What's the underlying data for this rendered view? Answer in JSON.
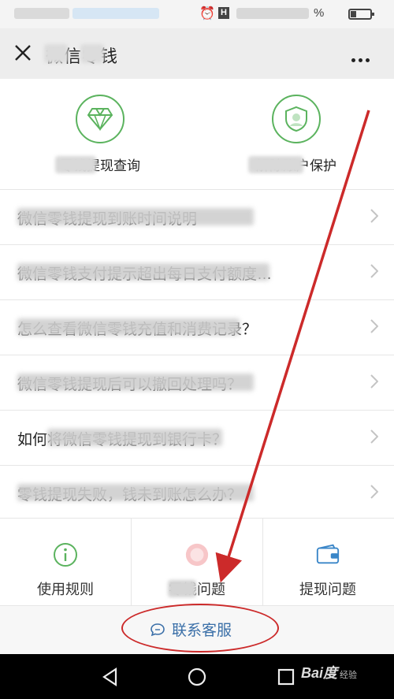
{
  "status_bar": {
    "battery_suffix": "%"
  },
  "header": {
    "title": "微信零钱"
  },
  "features": [
    {
      "label": "零钱提现查询"
    },
    {
      "label": "解除账户保护"
    }
  ],
  "faq": [
    {
      "text": "微信零钱提现到账时间说明"
    },
    {
      "text": "微信零钱支付提示超出每日支付额度…"
    },
    {
      "text": "怎么查看微信零钱充值和消费记录？"
    },
    {
      "text": "微信零钱提现后可以撤回处理吗？"
    },
    {
      "text": "如何将微信零钱提现到银行卡？"
    },
    {
      "text": "零钱提现失败，钱未到账怎么办？"
    }
  ],
  "bottom_tabs": [
    {
      "label": "使用规则",
      "icon": "info-icon"
    },
    {
      "label": "零钱问题",
      "icon": "coin-icon"
    },
    {
      "label": "提现问题",
      "icon": "wallet-icon"
    }
  ],
  "service": {
    "label": "联系客服",
    "icon": "chat-bubble-icon"
  },
  "watermark": {
    "brand": "Bai度",
    "sub": "经验"
  },
  "colors": {
    "accent_green": "#5bb35e",
    "link_blue": "#3a6fa8",
    "annotation_red": "#cc2a2a"
  }
}
